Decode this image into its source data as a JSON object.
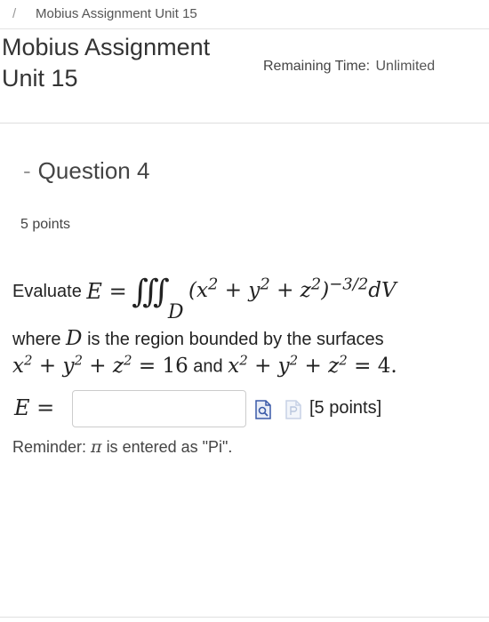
{
  "breadcrumb": {
    "separator": "/",
    "item": "Mobius Assignment Unit 15"
  },
  "header": {
    "title": "Mobius Assignment Unit 15",
    "remaining_label": "Remaining Time:",
    "remaining_value": "Unlimited"
  },
  "question": {
    "dash": "-",
    "title": "Question 4",
    "points": "5 points",
    "evaluate_label": "Evaluate",
    "E": "E",
    "equals": "=",
    "integral_sign": "∭",
    "region": "D",
    "integrand_open": "(x",
    "exp2": "2",
    "plus_y": " + y",
    "plus_z": " + z",
    "close_paren": ")",
    "neg_exp": "−3/2",
    "dV": "dV",
    "where": "where",
    "D": "D",
    "region_text": "is the region bounded by the surfaces",
    "surface1_rhs": " = 16",
    "and": "and",
    "surface2_rhs": " = 4.",
    "x": "x",
    "y": "y",
    "z": "z",
    "plus": " + "
  },
  "answer": {
    "label": "E =",
    "value": "",
    "placeholder": "",
    "points_label": "[5 points]",
    "preview_icon": "preview-icon",
    "format_icon": "format-icon"
  },
  "reminder": {
    "prefix": "Reminder:",
    "pi": "π",
    "suffix": "is entered as \"Pi\"."
  },
  "colors": {
    "icon_blue": "#3a5aa8",
    "icon_light": "#c7d2e6"
  }
}
